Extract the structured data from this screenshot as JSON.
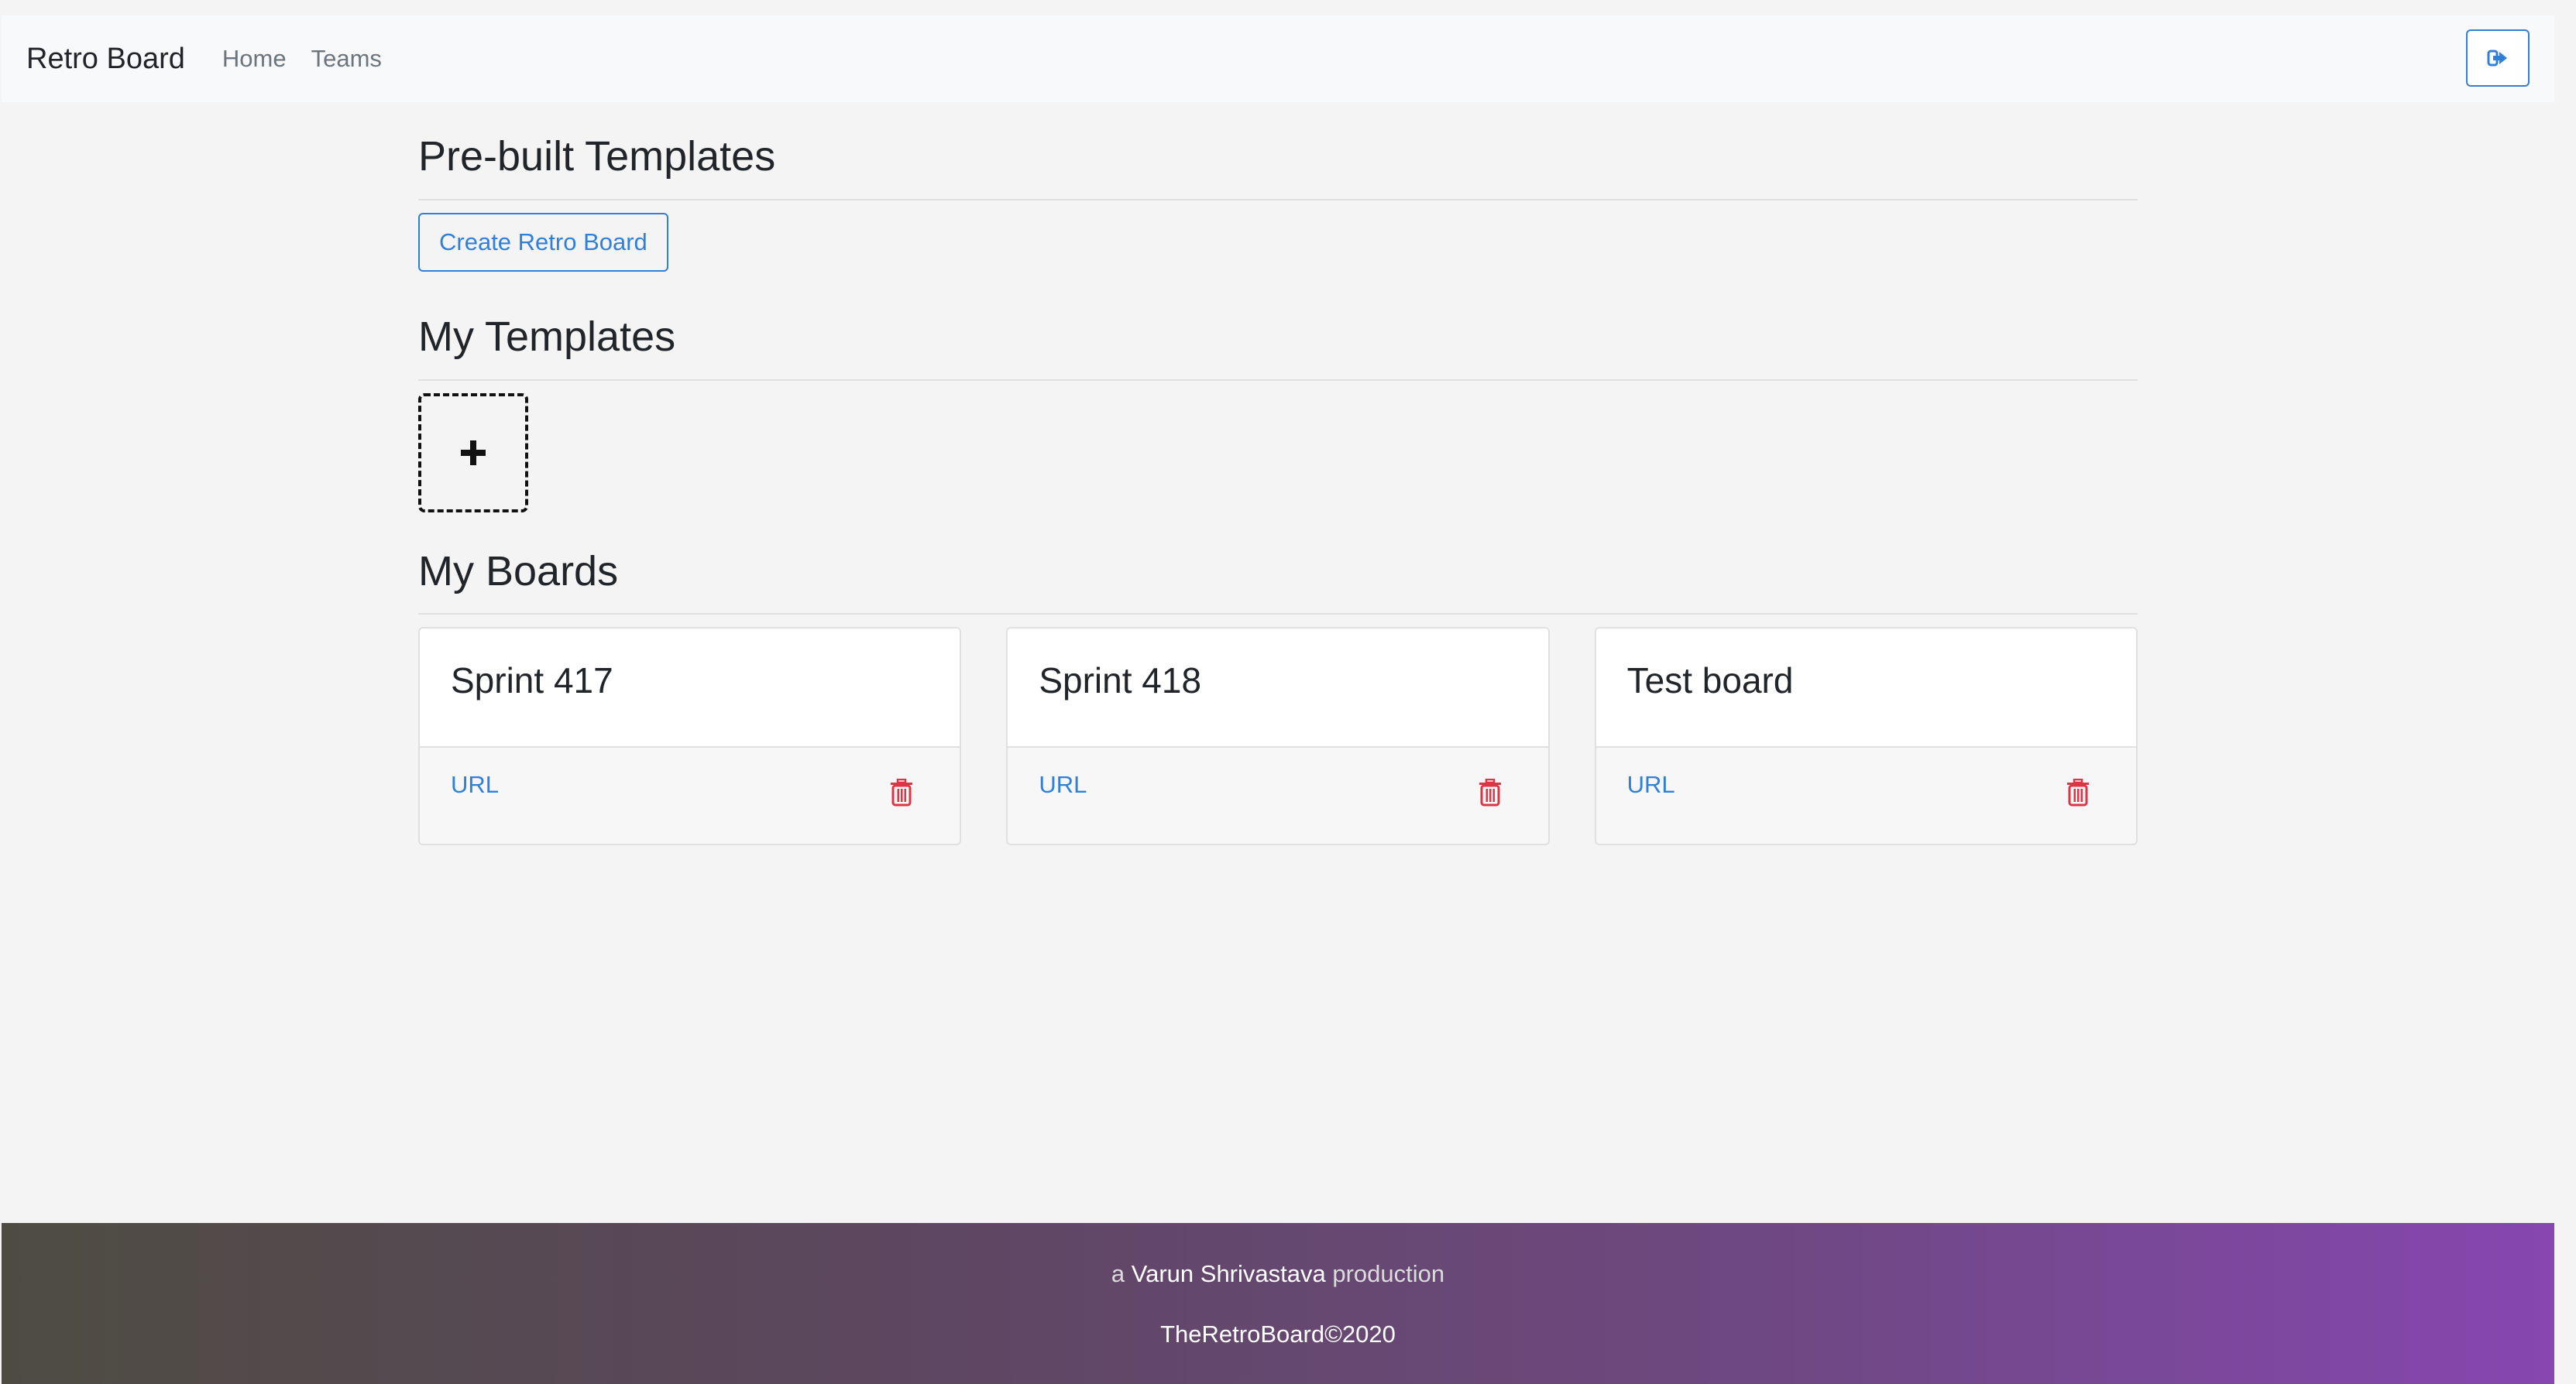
{
  "navbar": {
    "brand": "Retro Board",
    "links": [
      "Home",
      "Teams"
    ],
    "logout_icon": "sign-out-icon"
  },
  "sections": {
    "prebuilt": {
      "title": "Pre-built Templates",
      "create_button": "Create Retro Board"
    },
    "my_templates": {
      "title": "My Templates",
      "add_icon": "plus-icon"
    },
    "my_boards": {
      "title": "My Boards",
      "boards": [
        {
          "name": "Sprint 417",
          "link": "URL"
        },
        {
          "name": "Sprint 418",
          "link": "URL"
        },
        {
          "name": "Test board",
          "link": "URL"
        }
      ],
      "delete_icon": "trash-icon"
    }
  },
  "footer": {
    "prefix": "a",
    "author": "Varun Shrivastava",
    "suffix": "production",
    "copyright": "TheRetroBoard©2020"
  },
  "colors": {
    "primary": "#2f80d6",
    "danger": "#dc3545",
    "navbar_bg": "#f8f9fa",
    "page_bg": "#f4f4f4",
    "footer_gradient_start": "#4e4c42",
    "footer_gradient_end": "#8647b0"
  }
}
